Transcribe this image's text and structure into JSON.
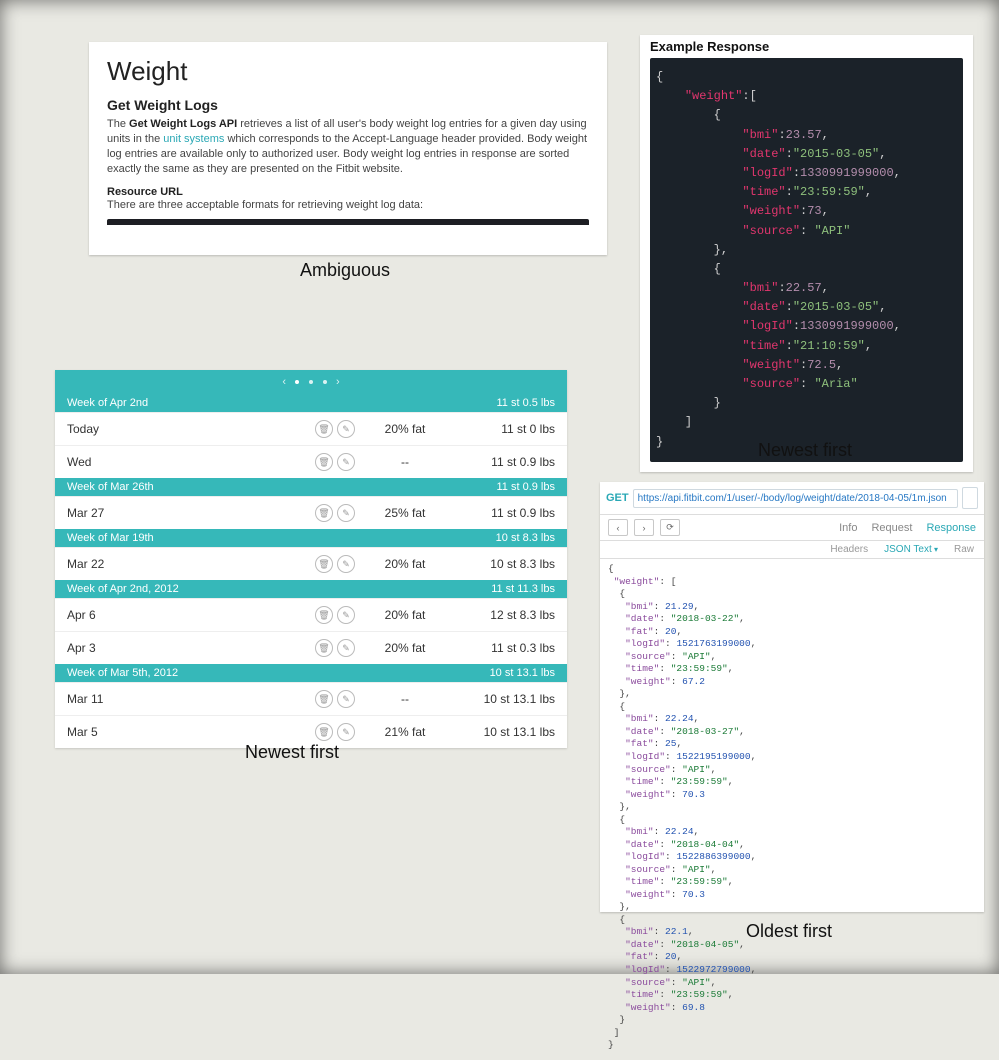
{
  "labels": {
    "ambiguous": "Ambiguous",
    "newest1": "Newest first",
    "newest2": "Newest first",
    "oldest": "Oldest first"
  },
  "doc": {
    "h1": "Weight",
    "h2": "Get Weight Logs",
    "p1_a": "The ",
    "p1_b": "Get Weight Logs API",
    "p1_c": " retrieves a list of all user's body weight log entries for a given day using units in the ",
    "link": "unit systems",
    "p1_d": " which corresponds to the Accept-Language header provided. Body weight log entries are available only to authorized user. Body weight log entries in response are sorted exactly the same as they are presented on the Fitbit website.",
    "resource_head": "Resource URL",
    "resource_text": "There are three acceptable formats for retrieving weight log data:"
  },
  "example": {
    "title": "Example Response",
    "entries": [
      {
        "bmi": "23.57",
        "date": "2015-03-05",
        "logId": "1330991999000",
        "time": "23:59:59",
        "weight": "73",
        "source": "API"
      },
      {
        "bmi": "22.57",
        "date": "2015-03-05",
        "logId": "1330991999000",
        "time": "21:10:59",
        "weight": "72.5",
        "source": "Aria"
      }
    ]
  },
  "wt_table": {
    "sections": [
      {
        "head": "Week of Apr 2nd",
        "summary": "11 st 0.5 lbs",
        "rows": [
          {
            "day": "Today",
            "fat": "20% fat",
            "wt": "11 st 0 lbs",
            "icons": true
          },
          {
            "day": "Wed",
            "fat": "--",
            "wt": "11 st 0.9 lbs",
            "icons": true
          }
        ]
      },
      {
        "head": "Week of Mar 26th",
        "summary": "11 st 0.9 lbs",
        "rows": [
          {
            "day": "Mar 27",
            "fat": "25% fat",
            "wt": "11 st 0.9 lbs",
            "icons": true
          }
        ]
      },
      {
        "head": "Week of Mar 19th",
        "summary": "10 st 8.3 lbs",
        "rows": [
          {
            "day": "Mar 22",
            "fat": "20% fat",
            "wt": "10 st 8.3 lbs",
            "icons": true
          }
        ]
      },
      {
        "head": "Week of Apr 2nd, 2012",
        "summary": "11 st 11.3 lbs",
        "rows": [
          {
            "day": "Apr 6",
            "fat": "20% fat",
            "wt": "12 st 8.3 lbs",
            "icons": true
          },
          {
            "day": "Apr 3",
            "fat": "20% fat",
            "wt": "11 st 0.3 lbs",
            "icons": true
          }
        ]
      },
      {
        "head": "Week of Mar 5th, 2012",
        "summary": "10 st 13.1 lbs",
        "rows": [
          {
            "day": "Mar 11",
            "fat": "--",
            "wt": "10 st 13.1 lbs",
            "icons": true
          },
          {
            "day": "Mar 5",
            "fat": "21% fat",
            "wt": "10 st 13.1 lbs",
            "icons": true
          }
        ]
      }
    ]
  },
  "explorer": {
    "method": "GET",
    "url": "https://api.fitbit.com/1/user/-/body/log/weight/date/2018-04-05/1m.json",
    "tabs": {
      "info": "Info",
      "request": "Request",
      "response": "Response"
    },
    "subtabs": {
      "headers": "Headers",
      "json": "JSON Text",
      "raw": "Raw"
    },
    "entries": [
      {
        "bmi": "21.29",
        "date": "2018-03-22",
        "fat": "20",
        "logId": "1521763199000",
        "source": "API",
        "time": "23:59:59",
        "weight": "67.2"
      },
      {
        "bmi": "22.24",
        "date": "2018-03-27",
        "fat": "25",
        "logId": "1522195199000",
        "source": "API",
        "time": "23:59:59",
        "weight": "70.3"
      },
      {
        "bmi": "22.24",
        "date": "2018-04-04",
        "logId": "1522886399000",
        "source": "API",
        "time": "23:59:59",
        "weight": "70.3"
      },
      {
        "bmi": "22.1",
        "date": "2018-04-05",
        "fat": "20",
        "logId": "1522972799000",
        "source": "API",
        "time": "23:59:59",
        "weight": "69.8"
      }
    ]
  }
}
